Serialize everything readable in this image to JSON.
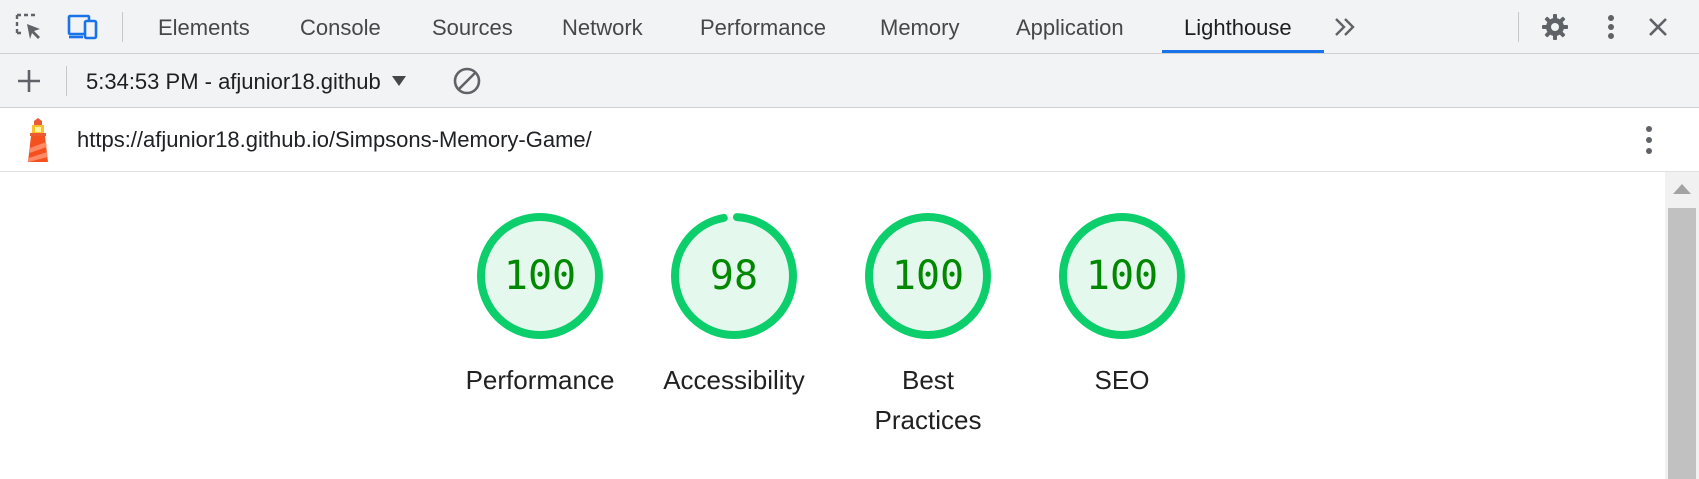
{
  "tabs": [
    {
      "label": "Elements"
    },
    {
      "label": "Console"
    },
    {
      "label": "Sources"
    },
    {
      "label": "Network"
    },
    {
      "label": "Performance"
    },
    {
      "label": "Memory"
    },
    {
      "label": "Application"
    },
    {
      "label": "Lighthouse"
    }
  ],
  "active_tab": "Lighthouse",
  "toolbar": {
    "report_selector": "5:34:53 PM - afjunior18.github"
  },
  "url_bar": {
    "url": "https://afjunior18.github.io/Simpsons-Memory-Game/"
  },
  "scores": [
    {
      "label": "Performance",
      "value": "100",
      "fraction": 1.0
    },
    {
      "label": "Accessibility",
      "value": "98",
      "fraction": 0.98
    },
    {
      "label": "Best Practices",
      "value": "100",
      "fraction": 1.0
    },
    {
      "label": "SEO",
      "value": "100",
      "fraction": 1.0
    }
  ],
  "colors": {
    "accent": "#1a73e8",
    "pass_ring": "#0cce6b",
    "pass_fill": "#e5f8ee",
    "pass_text": "#008800",
    "lighthouse_red": "#f4511e"
  },
  "icons": {
    "inspect": "inspect-element-icon",
    "device": "device-toolbar-icon",
    "more_tabs": "chevron-double-right-icon",
    "settings": "gear-icon",
    "menu": "kebab-menu-icon",
    "close": "close-icon",
    "new_report": "plus-icon",
    "dropdown": "triangle-down-icon",
    "clear": "clear-circle-icon",
    "lighthouse": "lighthouse-logo-icon",
    "report_menu": "kebab-menu-icon"
  }
}
